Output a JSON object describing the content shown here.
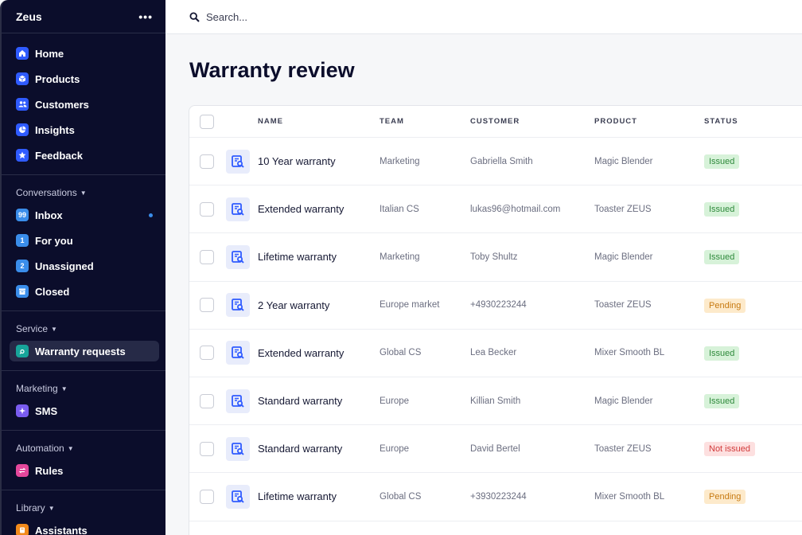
{
  "app": {
    "name": "Zeus",
    "more_label": "•••"
  },
  "sidebar": {
    "main_items": [
      {
        "label": "Home",
        "icon": "home-icon"
      },
      {
        "label": "Products",
        "icon": "box-icon"
      },
      {
        "label": "Customers",
        "icon": "people-icon"
      },
      {
        "label": "Insights",
        "icon": "pie-chart-icon"
      },
      {
        "label": "Feedback",
        "icon": "star-icon"
      }
    ],
    "conversations": {
      "label": "Conversations",
      "items": [
        {
          "label": "Inbox",
          "badge": "99"
        },
        {
          "label": "For you",
          "badge": "1"
        },
        {
          "label": "Unassigned",
          "badge": "2"
        },
        {
          "label": "Closed",
          "badge": ""
        }
      ]
    },
    "service": {
      "label": "Service",
      "items": [
        {
          "label": "Warranty requests"
        }
      ]
    },
    "marketing": {
      "label": "Marketing",
      "items": [
        {
          "label": "SMS"
        }
      ]
    },
    "automation": {
      "label": "Automation",
      "items": [
        {
          "label": "Rules"
        }
      ]
    },
    "library": {
      "label": "Library",
      "items": [
        {
          "label": "Assistants"
        }
      ]
    }
  },
  "search": {
    "placeholder": "Search..."
  },
  "page": {
    "title": "Warranty review"
  },
  "table": {
    "columns": {
      "name": "NAME",
      "team": "TEAM",
      "customer": "CUSTOMER",
      "product": "PRODUCT",
      "status": "STATUS"
    },
    "rows": [
      {
        "name": "10 Year warranty",
        "team": "Marketing",
        "customer": "Gabriella Smith",
        "product": "Magic Blender",
        "status": "Issued"
      },
      {
        "name": "Extended warranty",
        "team": "Italian CS",
        "customer": "lukas96@hotmail.com",
        "product": "Toaster ZEUS",
        "status": "Issued"
      },
      {
        "name": "Lifetime warranty",
        "team": "Marketing",
        "customer": "Toby Shultz",
        "product": "Magic Blender",
        "status": "Issued"
      },
      {
        "name": "2  Year warranty",
        "team": "Europe market",
        "customer": "+4930223244",
        "product": "Toaster ZEUS",
        "status": "Pending"
      },
      {
        "name": "Extended warranty",
        "team": "Global CS",
        "customer": "Lea Becker",
        "product": "Mixer Smooth BL",
        "status": "Issued"
      },
      {
        "name": "Standard warranty",
        "team": "Europe",
        "customer": "Killian Smith",
        "product": "Magic Blender",
        "status": "Issued"
      },
      {
        "name": "Standard warranty",
        "team": "Europe",
        "customer": "David Bertel",
        "product": "Toaster ZEUS",
        "status": "Not issued"
      },
      {
        "name": "Lifetime warranty",
        "team": "Global CS",
        "customer": "+3930223244",
        "product": "Mixer Smooth BL",
        "status": "Pending"
      }
    ]
  },
  "colors": {
    "sidebar_bg": "#0b0d2b",
    "accent": "#2f5bff",
    "issued": "#2f8a3c",
    "pending": "#c77a12",
    "not_issued": "#d23b3b"
  }
}
